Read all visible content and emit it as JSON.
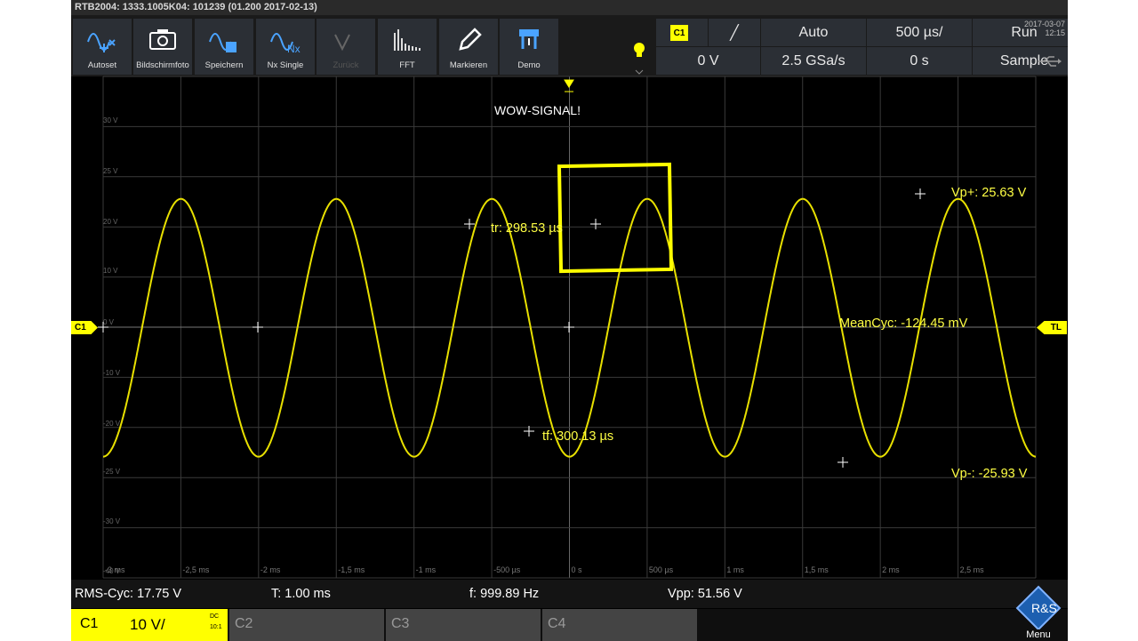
{
  "title_bar": "RTB2004: 1333.1005K04: 101239 (01.200 2017-02-13)",
  "toolbar": [
    {
      "label": "Autoset",
      "icon": "autoset-icon",
      "enabled": true
    },
    {
      "label": "Bildschirmfoto",
      "icon": "camera-icon",
      "enabled": true
    },
    {
      "label": "Speichern",
      "icon": "save-wave-icon",
      "enabled": true
    },
    {
      "label": "Nx Single",
      "icon": "single-acquisition-icon",
      "enabled": true
    },
    {
      "label": "Zurück",
      "icon": "undo-wave-icon",
      "enabled": false
    },
    {
      "label": "FFT",
      "icon": "fft-icon",
      "enabled": true
    },
    {
      "label": "Markieren",
      "icon": "pen-icon",
      "enabled": true
    },
    {
      "label": "Demo",
      "icon": "demo-icon",
      "enabled": true
    }
  ],
  "status": {
    "channel": "C1",
    "slope": "╱",
    "trigger_mode": "Auto",
    "timebase": "500 µs/",
    "run_state": "Run",
    "trigger_level": "0 V",
    "sample_rate": "2.5 GSa/s",
    "horizontal_offset": "0 s",
    "acquisition": "Sample"
  },
  "datetime": {
    "date": "2017-03-07",
    "time": "12:15"
  },
  "colors": {
    "accent": "#ffff00",
    "trace": "#e8e000",
    "grid": "#3a3a3a",
    "panel": "#2b2f35"
  },
  "plot": {
    "y_labels": [
      "30 V",
      "25 V",
      "20 V",
      "10 V",
      "0 V",
      "-10 V",
      "-20 V",
      "-25 V",
      "-30 V",
      "-40 V"
    ],
    "x_labels": [
      "-3 ms",
      "-2,5 ms",
      "-2 ms",
      "-1,5 ms",
      "-1 ms",
      "-500 µs",
      "0 s",
      "500 µs",
      "1 ms",
      "1,5 ms",
      "2 ms",
      "2,5 ms"
    ],
    "channel_marker": "C1",
    "trigger_marker": "TL",
    "annotation_text": "WOW-SIGNAL!"
  },
  "annotations": {
    "rise_time": "tr: 298.53 µs",
    "fall_time": "tf: 300.13 µs",
    "vp_plus": "Vp+: 25.63 V",
    "vp_minus": "Vp-: -25.93 V",
    "mean_cyc": "MeanCyc: -124.45 mV"
  },
  "measurements": {
    "rms_cyc": "RMS-Cyc: 17.75 V",
    "period": "T: 1.00 ms",
    "frequency": "f: 999.89 Hz",
    "vpp": "Vpp: 51.56 V"
  },
  "channels": [
    {
      "name": "C1",
      "scale": "10 V/",
      "coupling": "DC",
      "attenuation": "10:1",
      "active": true
    },
    {
      "name": "C2",
      "active": false
    },
    {
      "name": "C3",
      "active": false
    },
    {
      "name": "C4",
      "active": false
    }
  ],
  "menu_label": "Menu",
  "chart_data": {
    "type": "line",
    "series": [
      {
        "x_unit": "ms",
        "y_unit": "V",
        "frequency_hz": 999.89,
        "amplitude_v": 25.7,
        "offset_v": -0.124
      }
    ],
    "xlim": [
      -3,
      3
    ],
    "ylim": [
      -50,
      50
    ],
    "grid": true
  }
}
